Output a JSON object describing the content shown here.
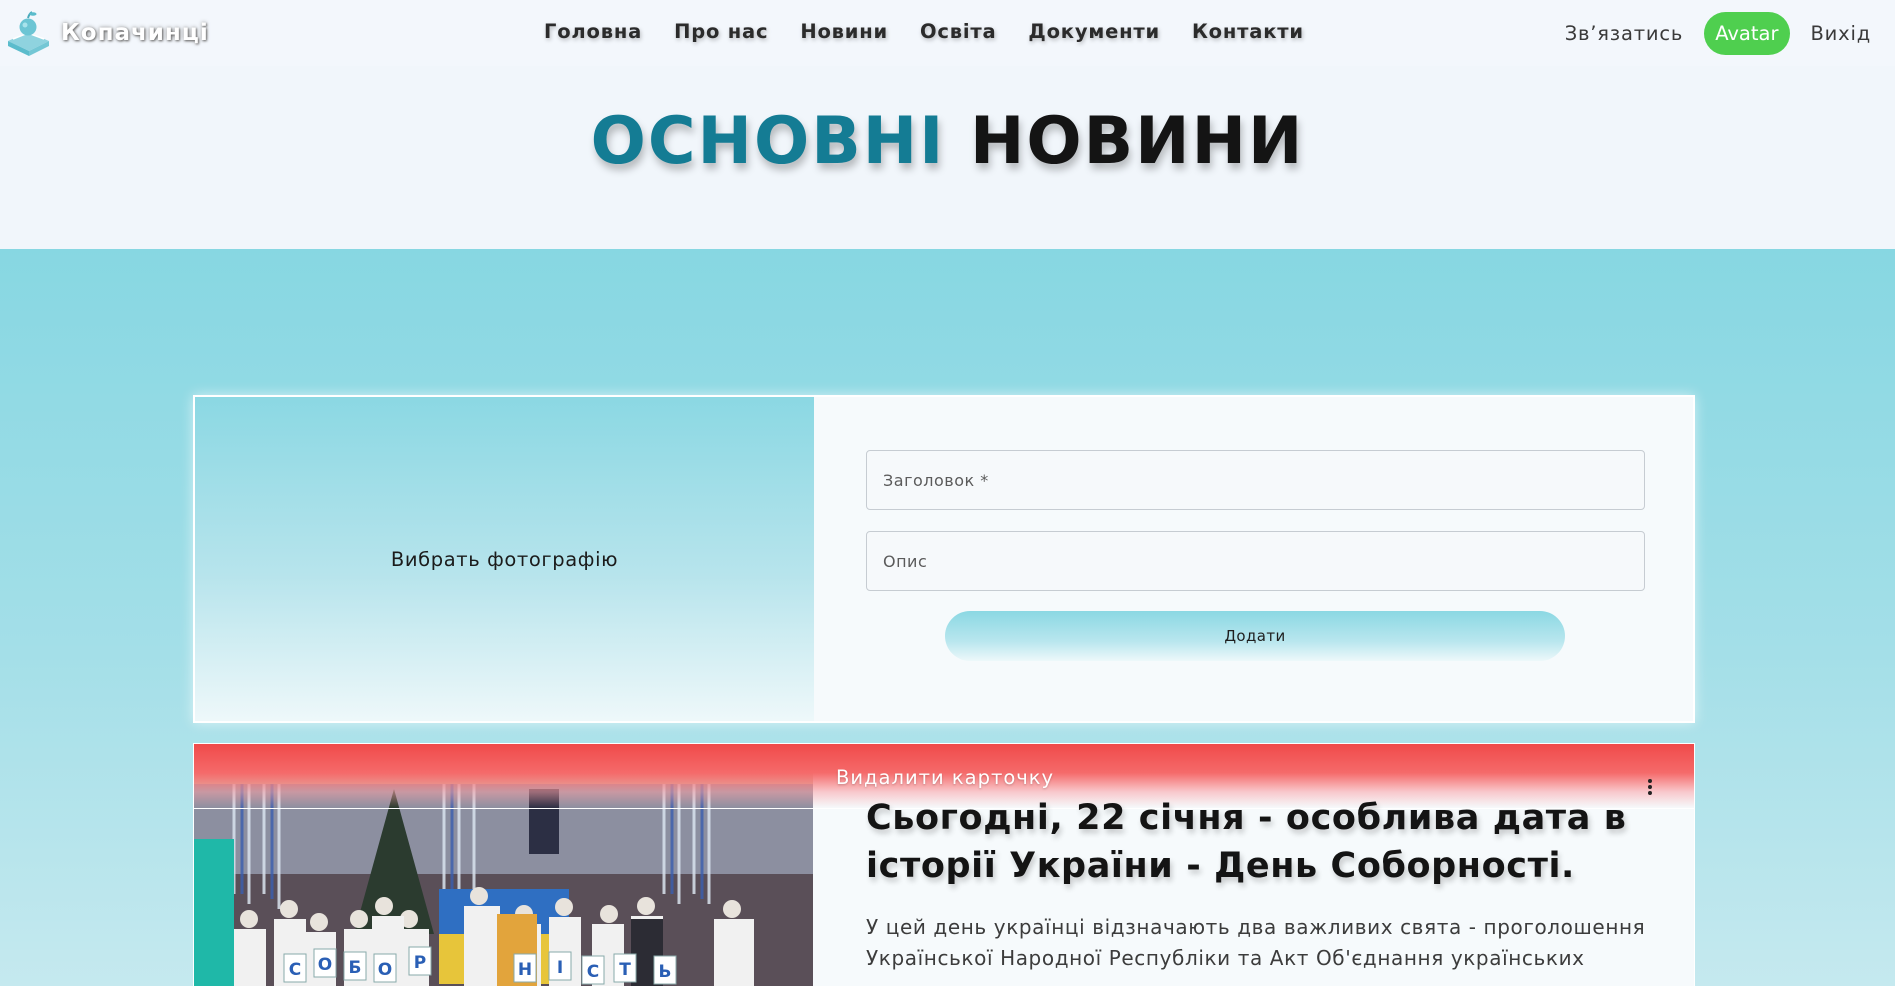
{
  "header": {
    "brand_name": "Копачинці",
    "logo_icon": "apple-book-logo-icon",
    "nav": [
      {
        "label": "Головна"
      },
      {
        "label": "Про нас"
      },
      {
        "label": "Новини"
      },
      {
        "label": "Освіта"
      },
      {
        "label": "Документи"
      },
      {
        "label": "Контакти"
      }
    ],
    "contact_label": "Зв’язатись",
    "avatar_label": "Avatar",
    "logout_label": "Вихід"
  },
  "page": {
    "title_accent": "ОСНОВНІ",
    "title_rest": "НОВИНИ"
  },
  "add_form": {
    "photo_label": "Вибрать фотографію",
    "title_placeholder": "Заголовок *",
    "description_placeholder": "Опис",
    "submit_label": "Додати"
  },
  "news": [
    {
      "delete_label": "Видалити карточку",
      "menu_icon": "more-vertical-icon",
      "title": "Сьогодні, 22 січня - особлива дата в історії України - День Соборності.",
      "text": "У цей день українці відзначають два важливих свята - проголошення Української Народної Республіки та Акт Об'єднання українських",
      "image_letters": [
        "С",
        "О",
        "Б",
        "О",
        "Р",
        "Н",
        "І",
        "С",
        "Т",
        "Ь"
      ]
    }
  ],
  "colors": {
    "accent": "#147c94",
    "band_top": "#87d7e2",
    "avatar_bg": "#4fcf4f",
    "delete_bar": "#f04a4a"
  }
}
